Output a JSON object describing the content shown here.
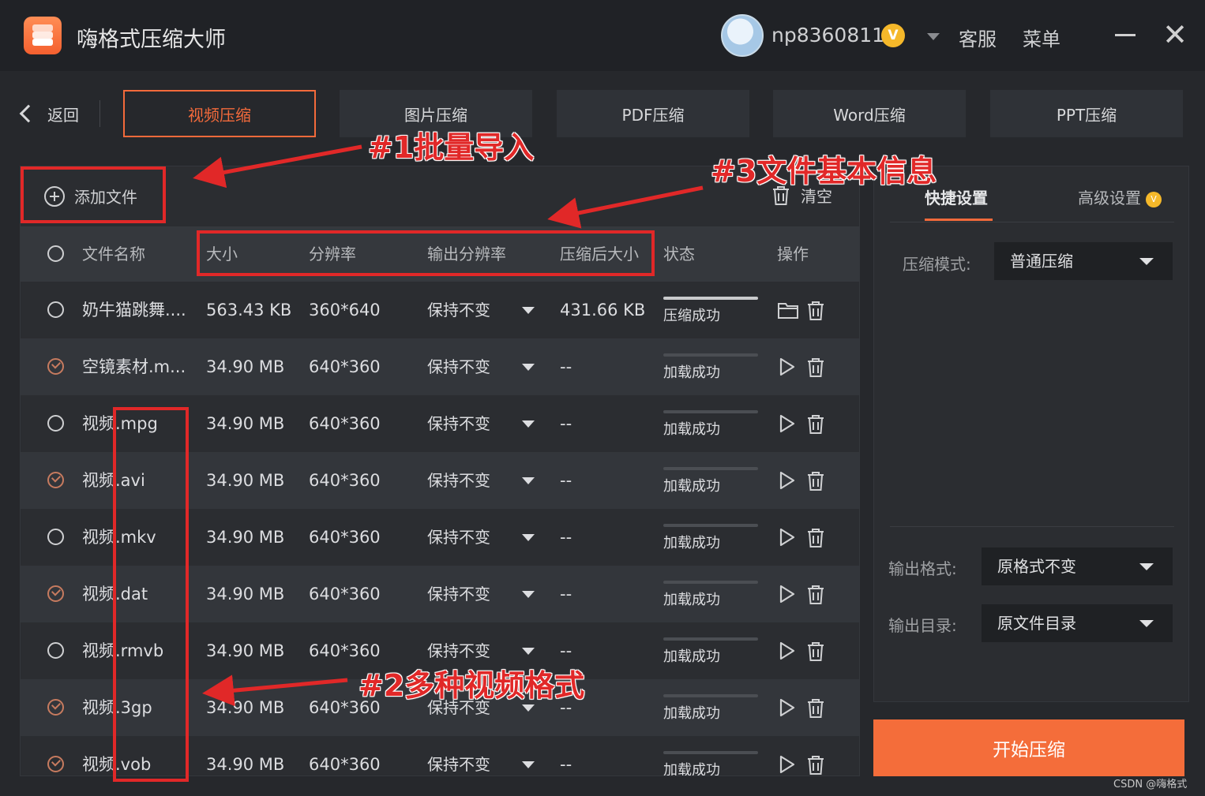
{
  "app": {
    "title": "嗨格式压缩大师"
  },
  "user": {
    "name": "np8360811",
    "vip_badge": "V"
  },
  "topbar": {
    "service": "客服",
    "menu": "菜单",
    "close": "✕"
  },
  "nav": {
    "back": "返回",
    "tabs": [
      {
        "label": "视频压缩",
        "active": true
      },
      {
        "label": "图片压缩"
      },
      {
        "label": "PDF压缩"
      },
      {
        "label": "Word压缩"
      },
      {
        "label": "PPT压缩"
      }
    ]
  },
  "toolbar": {
    "add_file": "添加文件",
    "clear": "清空"
  },
  "table": {
    "headers": {
      "name": "文件名称",
      "size": "大小",
      "resolution": "分辨率",
      "output_resolution": "输出分辨率",
      "compressed_size": "压缩后大小",
      "status": "状态",
      "actions": "操作"
    },
    "rows": [
      {
        "name": "奶牛猫跳舞....",
        "size": "563.43 KB",
        "resolution": "360*640",
        "output_resolution": "保持不变",
        "compressed_size": "431.66 KB",
        "status": "压缩成功",
        "progress": 1.0,
        "checked": false
      },
      {
        "name": "空镜素材.m...",
        "size": "34.90 MB",
        "resolution": "640*360",
        "output_resolution": "保持不变",
        "compressed_size": "--",
        "status": "加载成功",
        "progress": 0,
        "checked": true
      },
      {
        "name": "视频.mpg",
        "size": "34.90 MB",
        "resolution": "640*360",
        "output_resolution": "保持不变",
        "compressed_size": "--",
        "status": "加载成功",
        "progress": 0,
        "checked": false
      },
      {
        "name": "视频.avi",
        "size": "34.90 MB",
        "resolution": "640*360",
        "output_resolution": "保持不变",
        "compressed_size": "--",
        "status": "加载成功",
        "progress": 0,
        "checked": true
      },
      {
        "name": "视频.mkv",
        "size": "34.90 MB",
        "resolution": "640*360",
        "output_resolution": "保持不变",
        "compressed_size": "--",
        "status": "加载成功",
        "progress": 0,
        "checked": false
      },
      {
        "name": "视频.dat",
        "size": "34.90 MB",
        "resolution": "640*360",
        "output_resolution": "保持不变",
        "compressed_size": "--",
        "status": "加载成功",
        "progress": 0,
        "checked": true
      },
      {
        "name": "视频.rmvb",
        "size": "34.90 MB",
        "resolution": "640*360",
        "output_resolution": "保持不变",
        "compressed_size": "--",
        "status": "加载成功",
        "progress": 0,
        "checked": false
      },
      {
        "name": "视频.3gp",
        "size": "34.90 MB",
        "resolution": "640*360",
        "output_resolution": "保持不变",
        "compressed_size": "--",
        "status": "加载成功",
        "progress": 0,
        "checked": true
      },
      {
        "name": "视频.vob",
        "size": "34.90 MB",
        "resolution": "640*360",
        "output_resolution": "保持不变",
        "compressed_size": "--",
        "status": "加载成功",
        "progress": 0,
        "checked": true
      }
    ]
  },
  "settings": {
    "tabs": {
      "quick": "快捷设置",
      "advanced": "高级设置",
      "advanced_badge": "V"
    },
    "compress_mode": {
      "label": "压缩模式:",
      "value": "普通压缩"
    },
    "output_format": {
      "label": "输出格式:",
      "value": "原格式不变"
    },
    "output_dir": {
      "label": "输出目录:",
      "value": "原文件目录"
    }
  },
  "start_button": "开始压缩",
  "annotations": {
    "batch_import": "#1批量导入",
    "video_formats": "#2多种视频格式",
    "file_info": "#3文件基本信息",
    "color": "#e12828"
  },
  "watermark": "CSDN @嗨格式",
  "colors": {
    "accent": "#f36a3b",
    "start_button": "#f46d3a",
    "background": "#26282c"
  }
}
